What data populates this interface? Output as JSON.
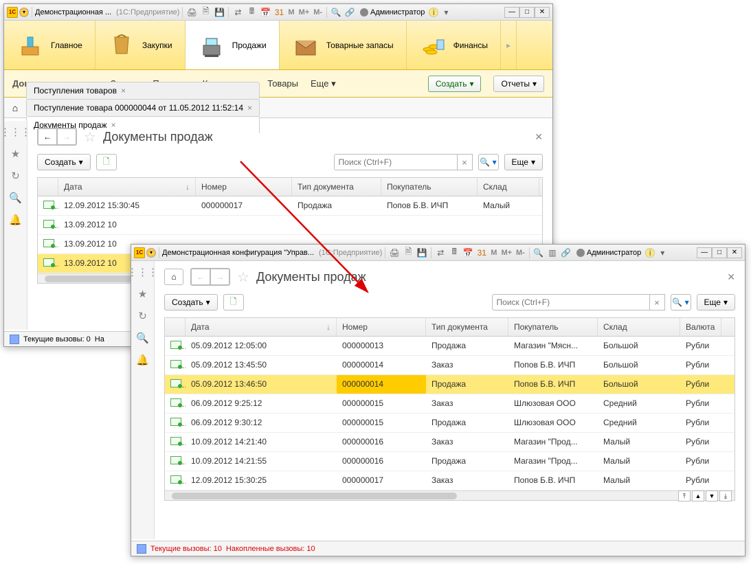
{
  "win1": {
    "title_app": "Демонстрационная ...",
    "title_mode": "(1С:Предприятие)",
    "user": "Администратор",
    "nav": [
      "Главное",
      "Закупки",
      "Продажи",
      "Товарные запасы",
      "Финансы"
    ],
    "nav_active": 2,
    "subnav_title": "Документы продаж",
    "subnav_items": [
      "Заказы",
      "Продажи",
      "Контрагенты",
      "Товары",
      "Еще"
    ],
    "btn_create": "Создать",
    "btn_reports": "Отчеты",
    "tabs": [
      {
        "label": "Поступления товаров",
        "active": false
      },
      {
        "label": "Поступление товара 000000044 от 11.05.2012 11:52:14",
        "active": false
      },
      {
        "label": "Документы продаж",
        "active": true
      }
    ],
    "page_title": "Документы продаж",
    "btn_create2": "Создать",
    "search_ph": "Поиск (Ctrl+F)",
    "btn_more": "Еще",
    "columns": [
      "Дата",
      "Номер",
      "Тип документа",
      "Покупатель",
      "Склад"
    ],
    "rows": [
      {
        "date": "12.09.2012 15:30:45",
        "num": "000000017",
        "type": "Продажа",
        "buyer": "Попов Б.В. ИЧП",
        "wh": "Малый",
        "sel": false
      },
      {
        "date": "13.09.2012 10",
        "num": "",
        "type": "",
        "buyer": "",
        "wh": "",
        "sel": false
      },
      {
        "date": "13.09.2012 10",
        "num": "",
        "type": "",
        "buyer": "",
        "wh": "",
        "sel": false
      },
      {
        "date": "13.09.2012 10",
        "num": "",
        "type": "",
        "buyer": "",
        "wh": "",
        "sel": true
      }
    ],
    "status_calls": "Текущие вызовы: 0",
    "status_acc": "На"
  },
  "win2": {
    "title_app": "Демонстрационная конфигурация \"Управ...",
    "title_mode": "(1С:Предприятие)",
    "user": "Администратор",
    "page_title": "Документы продаж",
    "btn_create": "Создать",
    "search_ph": "Поиск (Ctrl+F)",
    "btn_more": "Еще",
    "columns": [
      "Дата",
      "Номер",
      "Тип документа",
      "Покупатель",
      "Склад",
      "Валюта"
    ],
    "rows": [
      {
        "date": "05.09.2012 12:05:00",
        "num": "000000013",
        "type": "Продажа",
        "buyer": "Магазин \"Мясн...",
        "wh": "Большой",
        "cur": "Рубли",
        "sel": false
      },
      {
        "date": "05.09.2012 13:45:50",
        "num": "000000014",
        "type": "Заказ",
        "buyer": "Попов Б.В. ИЧП",
        "wh": "Большой",
        "cur": "Рубли",
        "sel": false
      },
      {
        "date": "05.09.2012 13:46:50",
        "num": "000000014",
        "type": "Продажа",
        "buyer": "Попов Б.В. ИЧП",
        "wh": "Большой",
        "cur": "Рубли",
        "sel": true,
        "hl": "num"
      },
      {
        "date": "06.09.2012 9:25:12",
        "num": "000000015",
        "type": "Заказ",
        "buyer": "Шлюзовая ООО",
        "wh": "Средний",
        "cur": "Рубли",
        "sel": false
      },
      {
        "date": "06.09.2012 9:30:12",
        "num": "000000015",
        "type": "Продажа",
        "buyer": "Шлюзовая ООО",
        "wh": "Средний",
        "cur": "Рубли",
        "sel": false
      },
      {
        "date": "10.09.2012 14:21:40",
        "num": "000000016",
        "type": "Заказ",
        "buyer": "Магазин \"Прод...",
        "wh": "Малый",
        "cur": "Рубли",
        "sel": false
      },
      {
        "date": "10.09.2012 14:21:55",
        "num": "000000016",
        "type": "Продажа",
        "buyer": "Магазин \"Прод...",
        "wh": "Малый",
        "cur": "Рубли",
        "sel": false
      },
      {
        "date": "12.09.2012 15:30:25",
        "num": "000000017",
        "type": "Заказ",
        "buyer": "Попов Б.В. ИЧП",
        "wh": "Малый",
        "cur": "Рубли",
        "sel": false
      }
    ],
    "status_calls": "Текущие вызовы: 10",
    "status_acc": "Накопленные вызовы: 10"
  }
}
